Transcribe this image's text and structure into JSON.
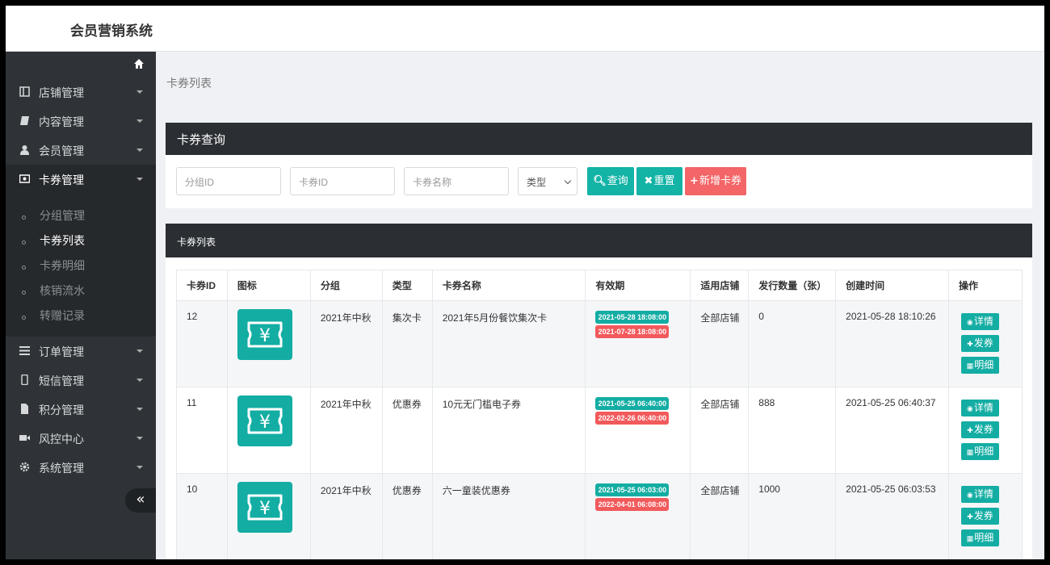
{
  "app": {
    "title": "会员营销系统"
  },
  "sidebar": {
    "home_icon": "home-icon",
    "items": [
      {
        "label": "店铺管理",
        "icon": "store-icon"
      },
      {
        "label": "内容管理",
        "icon": "book-icon"
      },
      {
        "label": "会员管理",
        "icon": "user-icon"
      },
      {
        "label": "卡券管理",
        "icon": "card-icon",
        "active": true
      },
      {
        "label": "订单管理",
        "icon": "list-icon"
      },
      {
        "label": "短信管理",
        "icon": "mobile-icon"
      },
      {
        "label": "积分管理",
        "icon": "file-icon"
      },
      {
        "label": "风控中心",
        "icon": "video-icon"
      },
      {
        "label": "系统管理",
        "icon": "gear-icon"
      }
    ],
    "subitems": [
      "分组管理",
      "卡券列表",
      "卡券明细",
      "核销流水",
      "转赠记录"
    ],
    "collapse_label": "«"
  },
  "breadcrumb": "卡券列表",
  "query": {
    "title": "卡券查询",
    "group_id_placeholder": "分组ID",
    "card_id_placeholder": "卡券ID",
    "card_name_placeholder": "卡券名称",
    "type_select": "类型",
    "search_label": "查询",
    "reset_label": "重置",
    "add_label": "新增卡券"
  },
  "list": {
    "title": "卡券列表",
    "columns": [
      "卡券ID",
      "图标",
      "分组",
      "类型",
      "卡券名称",
      "有效期",
      "适用店铺",
      "发行数量（张）",
      "创建时间",
      "操作"
    ],
    "rows": [
      {
        "id": "12",
        "group": "2021年中秋",
        "type": "集次卡",
        "name": "2021年5月份餐饮集次卡",
        "start": "2021-05-28 18:08:00",
        "end": "2021-07-28 18:08:00",
        "store": "全部店铺",
        "qty": "0",
        "created": "2021-05-28 18:10:26"
      },
      {
        "id": "11",
        "group": "2021年中秋",
        "type": "优惠券",
        "name": "10元无门槛电子券",
        "start": "2021-05-25 06:40:00",
        "end": "2022-02-26 06:40:00",
        "store": "全部店铺",
        "qty": "888",
        "created": "2021-05-25 06:40:37"
      },
      {
        "id": "10",
        "group": "2021年中秋",
        "type": "优惠券",
        "name": "六一童装优惠券",
        "start": "2021-05-25 06:03:00",
        "end": "2022-04-01 06:08:00",
        "store": "全部店铺",
        "qty": "1000",
        "created": "2021-05-25 06:03:53"
      }
    ],
    "actions": {
      "detail": "详情",
      "issue": "发券",
      "breakdown": "明细"
    }
  },
  "colors": {
    "accent": "#13ada3",
    "danger": "#f36567",
    "sidebar": "#2f3337",
    "header": "#2b2f33"
  }
}
